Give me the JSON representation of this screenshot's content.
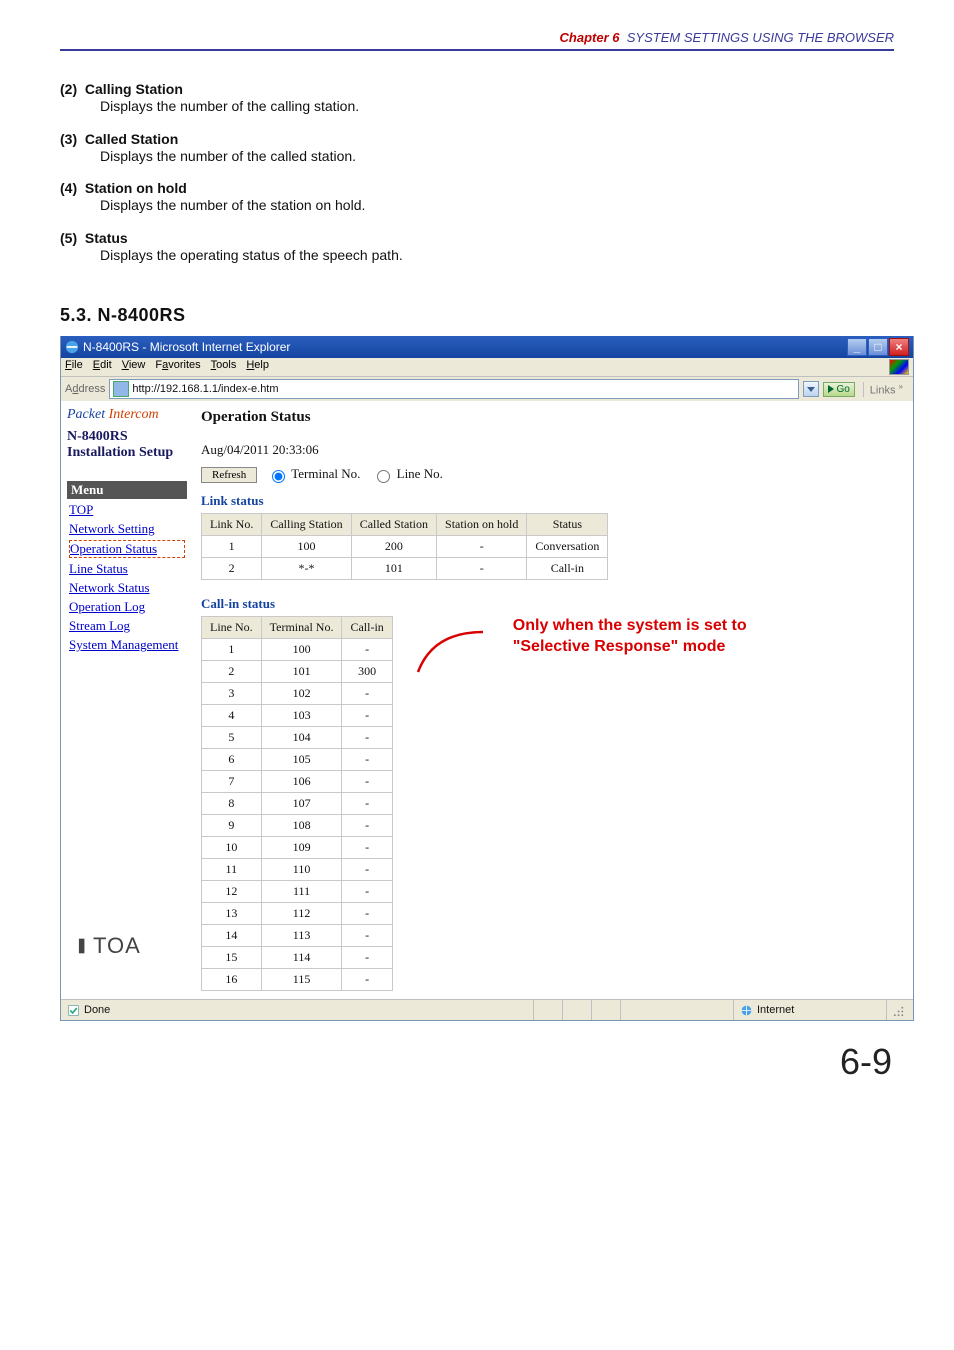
{
  "chapter": {
    "num": "Chapter 6",
    "title": "SYSTEM SETTINGS USING THE BROWSER"
  },
  "defs": [
    {
      "n": "(2)",
      "t": "Calling Station",
      "b": "Displays the number of the calling station."
    },
    {
      "n": "(3)",
      "t": "Called Station",
      "b": "Displays the number of the called station."
    },
    {
      "n": "(4)",
      "t": "Station on hold",
      "b": "Displays the number of the station on hold."
    },
    {
      "n": "(5)",
      "t": "Status",
      "b": "Displays the operating status of the speech path."
    }
  ],
  "section": "5.3. N-8400RS",
  "ie": {
    "title": "N-8400RS - Microsoft Internet Explorer",
    "menubar": [
      "File",
      "Edit",
      "View",
      "Favorites",
      "Tools",
      "Help"
    ],
    "address_label": "Address",
    "url": "http://192.168.1.1/index-e.htm",
    "go": "Go",
    "links": "Links"
  },
  "sidebar": {
    "brand_p": "Packet",
    "brand_i": "Intercom",
    "model": "N-8400RS",
    "setup": "Installation Setup",
    "menu_hdr": "Menu",
    "items": [
      "TOP",
      "Network Setting",
      "Operation Status",
      "Line Status",
      "Network Status",
      "Operation Log",
      "Stream Log",
      "System Management"
    ],
    "selected_index": 2,
    "toa": "TOA"
  },
  "main": {
    "h": "Operation Status",
    "timestamp": "Aug/04/2011 20:33:06",
    "refresh": "Refresh",
    "radio1": "Terminal No.",
    "radio2": "Line No.",
    "link_hdr": "Link status",
    "link_cols": [
      "Link No.",
      "Calling Station",
      "Called Station",
      "Station on hold",
      "Status"
    ],
    "link_rows": [
      [
        "1",
        "100",
        "200",
        "-",
        "Conversation"
      ],
      [
        "2",
        "*-*",
        "101",
        "-",
        "Call-in"
      ]
    ],
    "callin_hdr": "Call-in status",
    "callin_cols": [
      "Line No.",
      "Terminal No.",
      "Call-in"
    ],
    "callin_rows": [
      [
        "1",
        "100",
        "-"
      ],
      [
        "2",
        "101",
        "300"
      ],
      [
        "3",
        "102",
        "-"
      ],
      [
        "4",
        "103",
        "-"
      ],
      [
        "5",
        "104",
        "-"
      ],
      [
        "6",
        "105",
        "-"
      ],
      [
        "7",
        "106",
        "-"
      ],
      [
        "8",
        "107",
        "-"
      ],
      [
        "9",
        "108",
        "-"
      ],
      [
        "10",
        "109",
        "-"
      ],
      [
        "11",
        "110",
        "-"
      ],
      [
        "12",
        "111",
        "-"
      ],
      [
        "13",
        "112",
        "-"
      ],
      [
        "14",
        "113",
        "-"
      ],
      [
        "15",
        "114",
        "-"
      ],
      [
        "16",
        "115",
        "-"
      ]
    ],
    "note_l1": "Only when the system is set to",
    "note_l2": "\"Selective Response\" mode"
  },
  "statusbar": {
    "done": "Done",
    "zone": "Internet"
  },
  "pagenum": "6-9"
}
